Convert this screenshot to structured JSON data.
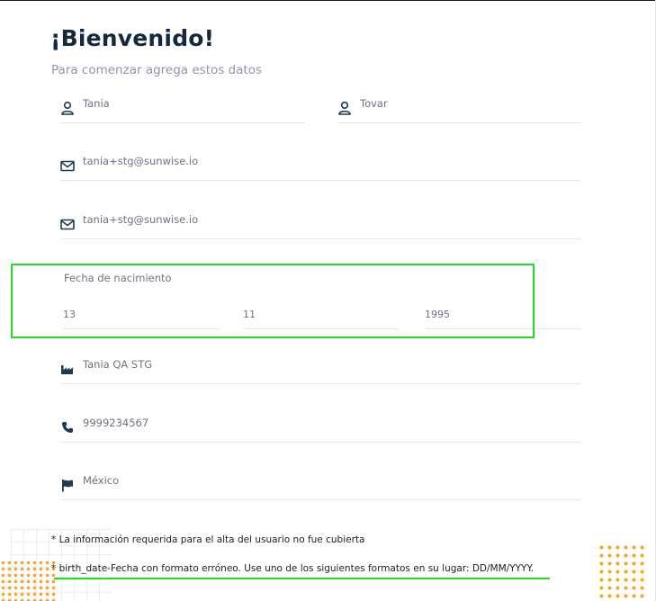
{
  "header": {
    "title": "¡Bienvenido!",
    "subtitle": "Para comenzar agrega estos datos"
  },
  "form": {
    "first_name": {
      "value": "Tania",
      "icon": "user-icon"
    },
    "last_name": {
      "value": "Tovar",
      "icon": "user-icon"
    },
    "email": {
      "value": "tania+stg@sunwise.io",
      "icon": "mail-icon"
    },
    "email_confirm": {
      "value": "tania+stg@sunwise.io",
      "icon": "mail-icon"
    },
    "birth_date": {
      "label": "Fecha de nacimiento",
      "day": "13",
      "month": "11",
      "year": "1995"
    },
    "company": {
      "value": "Tania QA STG",
      "icon": "factory-icon"
    },
    "phone": {
      "value": "9999234567",
      "icon": "phone-icon"
    },
    "country": {
      "value": "México",
      "icon": "flag-icon"
    }
  },
  "errors": {
    "required": "* La información requerida para el alta del usuario no fue cubierta",
    "birth_date": "* birth_date-Fecha con formato erróneo. Use uno de los siguientes formatos en su lugar: DD/MM/YYYY."
  },
  "colors": {
    "title": "#16283c",
    "subtitle": "#8e93b6",
    "icon": "#1f3a52",
    "highlight": "#22dd22",
    "accent_dots": "#f5a623"
  }
}
